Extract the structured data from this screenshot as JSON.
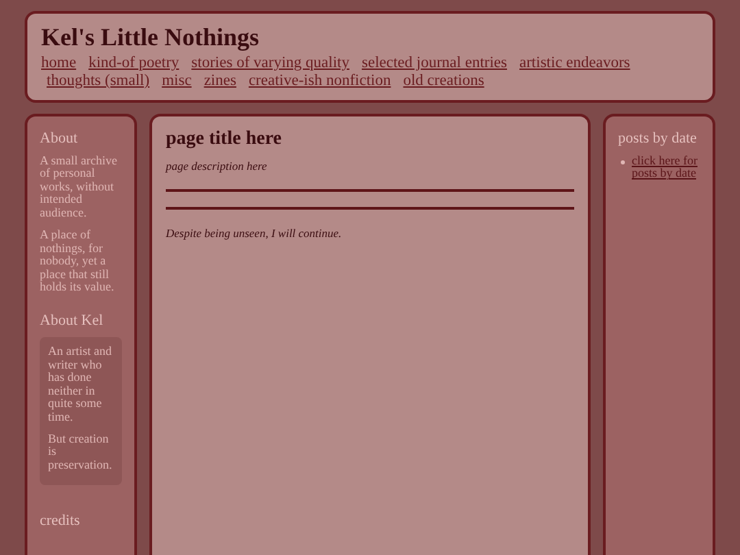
{
  "header": {
    "title": "Kel's Little Nothings",
    "nav": [
      {
        "label": "home"
      },
      {
        "label": "kind-of poetry"
      },
      {
        "label": "stories of varying quality"
      },
      {
        "label": "selected journal entries"
      },
      {
        "label": "artistic endeavors"
      },
      {
        "label": "thoughts (small)"
      },
      {
        "label": "misc"
      },
      {
        "label": "zines"
      },
      {
        "label": "creative-ish nonfiction"
      },
      {
        "label": "old creations"
      }
    ]
  },
  "left_sidebar": {
    "sections": [
      {
        "kind": "text",
        "heading": "About",
        "paragraphs": [
          "A small archive of personal works, without intended audience.",
          "A place of nothings, for nobody, yet a place that still holds its value."
        ]
      },
      {
        "kind": "card",
        "heading": "About Kel",
        "paragraphs": [
          "An artist and writer who has done neither in quite some time.",
          "But creation is preservation."
        ]
      },
      {
        "kind": "text",
        "heading": "credits"
      }
    ]
  },
  "main": {
    "title": "page title here",
    "description": "page description here",
    "body": "Despite being unseen, I will continue."
  },
  "right_sidebar": {
    "heading": "posts by date",
    "links": [
      {
        "label": "click here for posts by date"
      }
    ]
  }
}
